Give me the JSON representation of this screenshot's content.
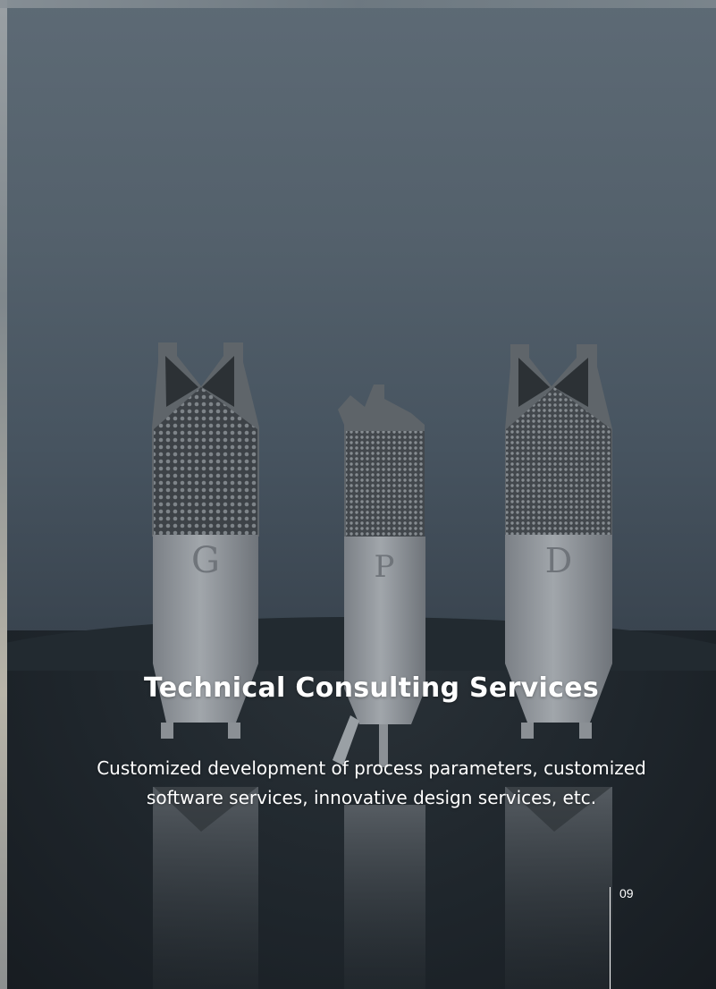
{
  "slide": {
    "title": "Technical Consulting Services",
    "description": "Customized development of process parameters, customized software services, innovative design services, etc.",
    "page_number": "09"
  },
  "image": {
    "parts": [
      {
        "name": "part-g",
        "letter": "G"
      },
      {
        "name": "part-p",
        "letter": "P"
      },
      {
        "name": "part-d",
        "letter": "D"
      }
    ]
  },
  "colors": {
    "background_top": "#5d6a75",
    "background_bottom": "#20272e",
    "part_metal": "#8a8f94",
    "text": "#ffffff"
  }
}
